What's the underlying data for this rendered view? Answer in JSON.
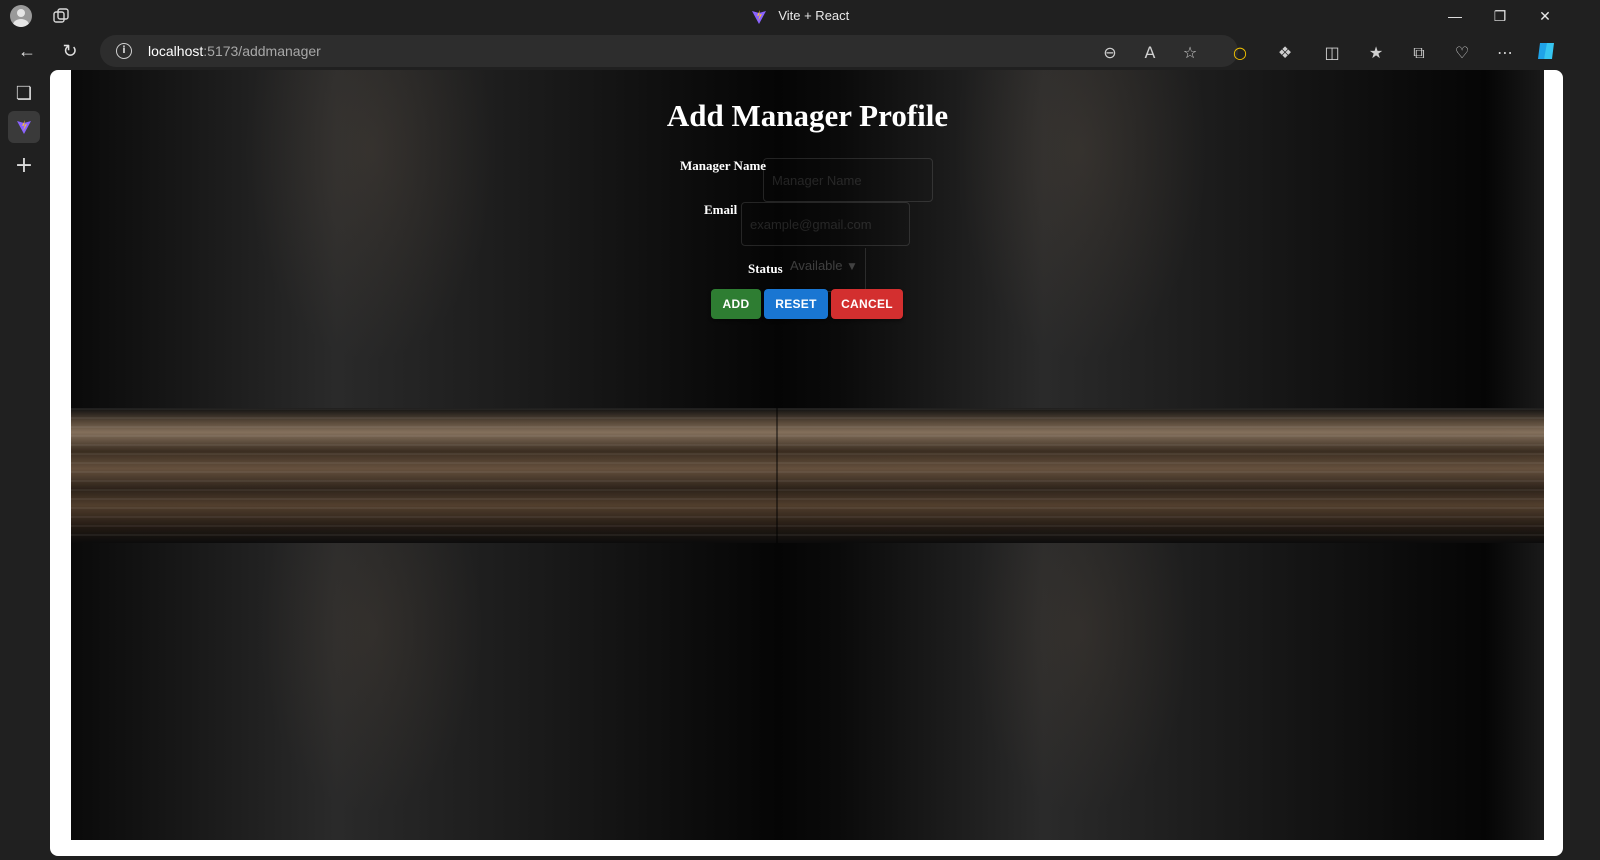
{
  "browser": {
    "tab_title": "Vite + React",
    "url_host": "localhost",
    "url_rest": ":5173/addmanager"
  },
  "page": {
    "title": "Add Manager Profile",
    "form": {
      "manager_name_label": "Manager Name",
      "manager_name_placeholder": "Manager Name",
      "email_label": "Email",
      "email_placeholder": "example@gmail.com",
      "status_label": "Status",
      "status_value": "Available"
    },
    "buttons": {
      "add": "ADD",
      "reset": "RESET",
      "cancel": "CANCEL"
    }
  },
  "colors": {
    "add": "#2e7d32",
    "reset": "#1976d2",
    "cancel": "#d32f2f"
  }
}
